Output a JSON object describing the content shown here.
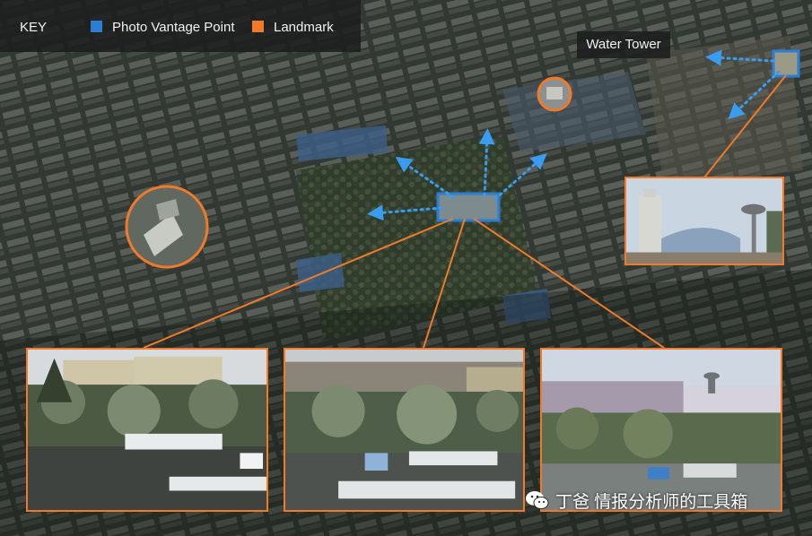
{
  "key": {
    "title": "KEY",
    "items": [
      {
        "label": "Photo Vantage Point",
        "color": "#2a7fd4"
      },
      {
        "label": "Landmark",
        "color": "#f07a2a"
      }
    ]
  },
  "landmark_label": "Water Tower",
  "watermark": "丁爸 情报分析师的工具箱",
  "colors": {
    "accent": "#f07a2a",
    "vantage": "#2a7fd4",
    "arrow": "#3a9cf0"
  }
}
